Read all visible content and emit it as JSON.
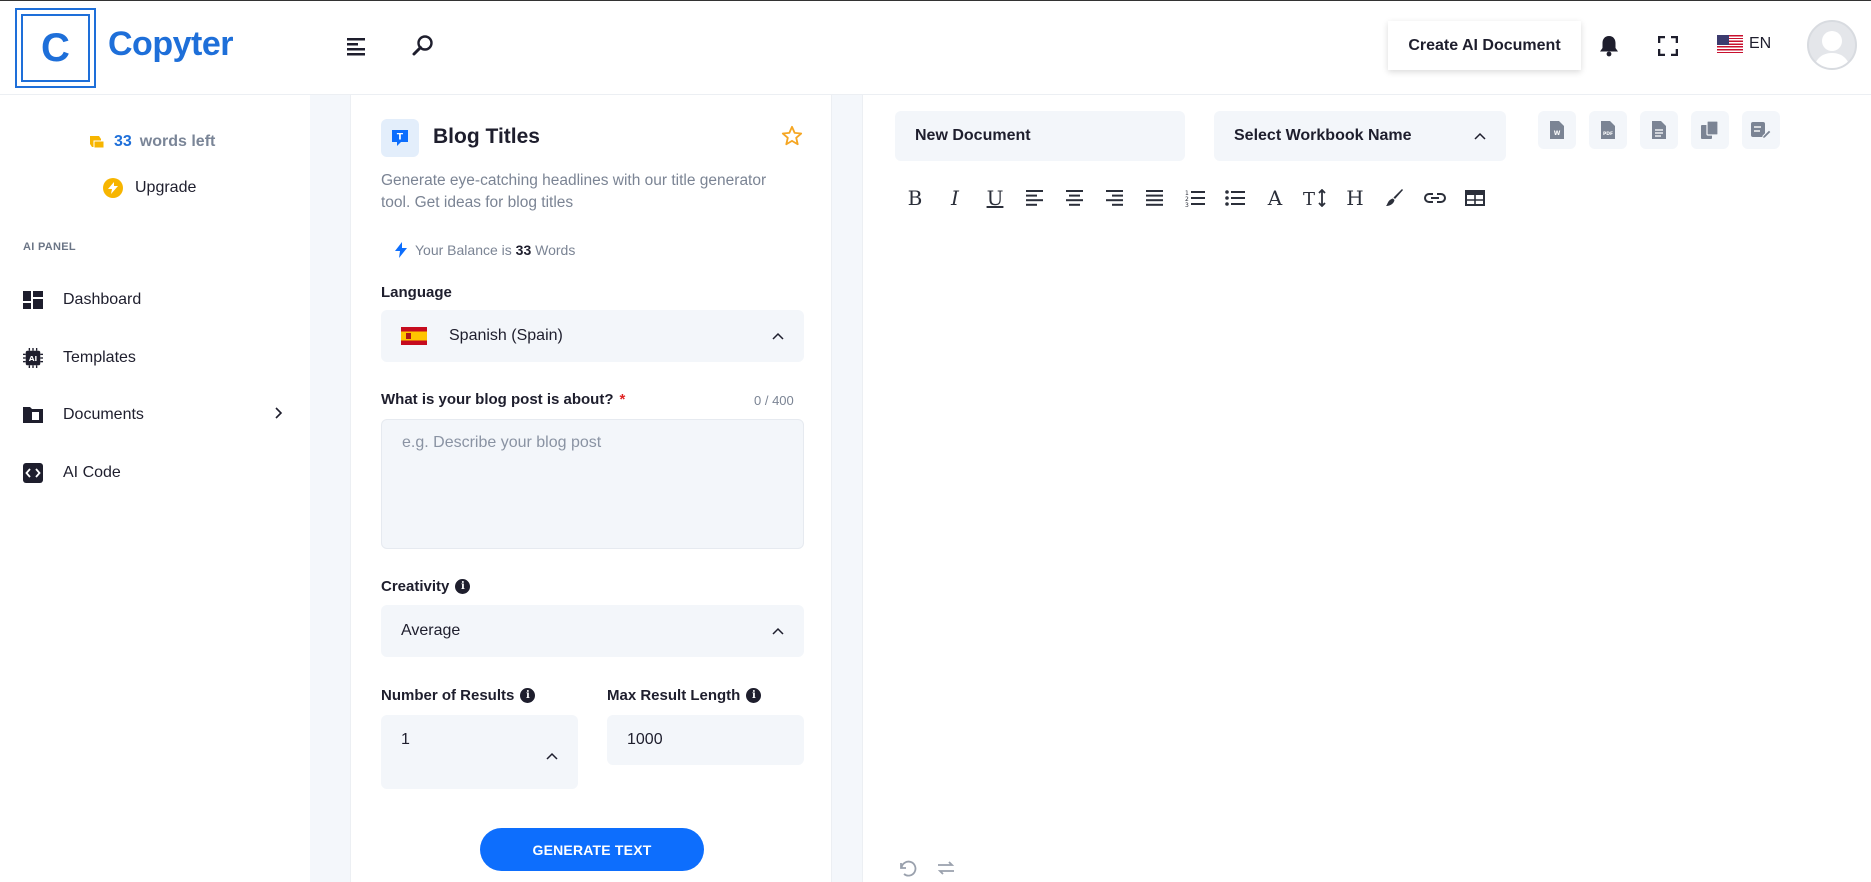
{
  "header": {
    "logo_letter": "C",
    "logo_text": "Copyter",
    "create_doc_label": "Create AI Document",
    "language_code": "EN"
  },
  "sidebar": {
    "words_count": "33",
    "words_suffix": "words left",
    "upgrade_label": "Upgrade",
    "panel_label": "AI PANEL",
    "items": [
      {
        "label": "Dashboard",
        "icon": "dashboard-icon"
      },
      {
        "label": "Templates",
        "icon": "ai-chip-icon"
      },
      {
        "label": "Documents",
        "icon": "folder-icon"
      },
      {
        "label": "AI Code",
        "icon": "code-icon"
      }
    ]
  },
  "form": {
    "title": "Blog Titles",
    "description": "Generate eye-catching headlines with our title generator tool. Get ideas for blog titles",
    "balance_prefix": "Your Balance is",
    "balance_count": "33",
    "balance_suffix": "Words",
    "language_label": "Language",
    "language_value": "Spanish (Spain)",
    "about_label": "What is your blog post is about?",
    "required_mark": "*",
    "about_counter": "0 / 400",
    "about_placeholder": "e.g. Describe your blog post",
    "creativity_label": "Creativity",
    "creativity_value": "Average",
    "results_label": "Number of Results",
    "results_value": "1",
    "max_length_label": "Max Result Length",
    "max_length_value": "1000",
    "generate_label": "GENERATE TEXT"
  },
  "editor": {
    "doc_name": "New Document",
    "workbook_placeholder": "Select Workbook Name",
    "toolbar_text": {
      "bold": "B",
      "italic": "I",
      "underline": "U",
      "font_color": "A",
      "heading": "H"
    }
  },
  "colors": {
    "brand": "#1e6fd9",
    "button": "#0d6efd",
    "star": "#f5a623"
  }
}
